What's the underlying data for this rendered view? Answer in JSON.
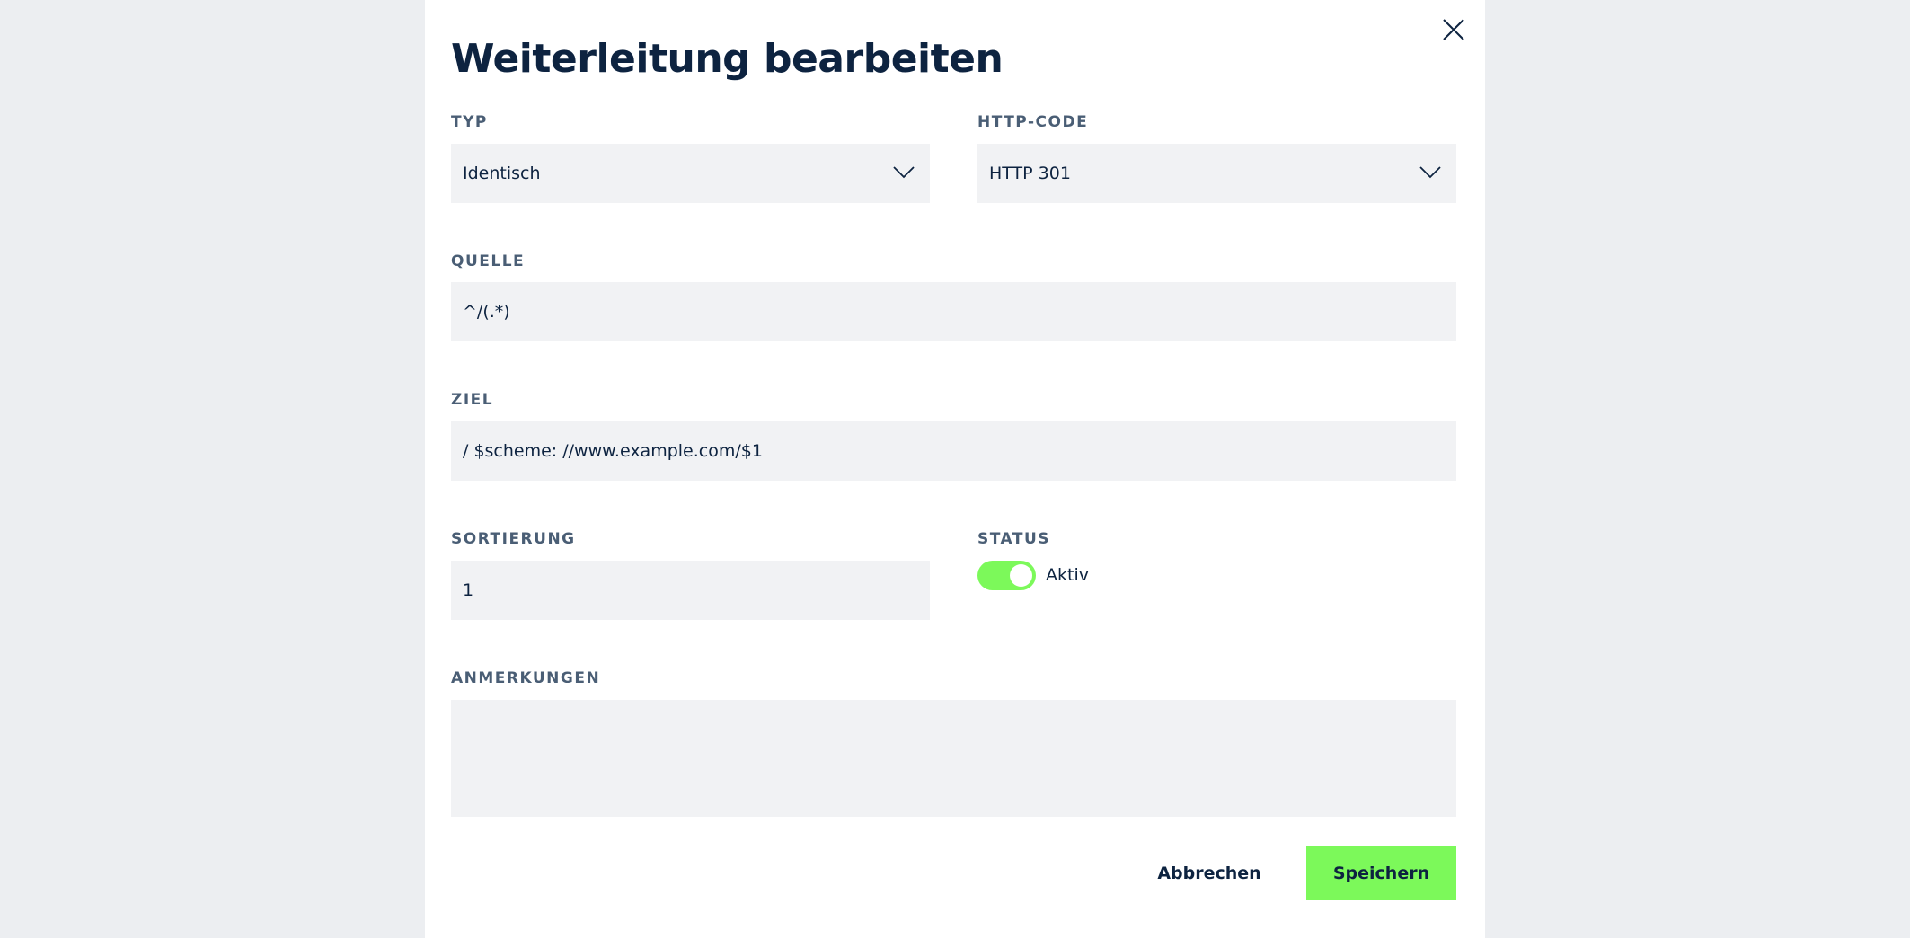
{
  "dialog": {
    "title": "Weiterleitung bearbeiten"
  },
  "fields": {
    "typ": {
      "label": "TYP",
      "value": "Identisch"
    },
    "http_code": {
      "label": "HTTP-CODE",
      "value": "HTTP 301"
    },
    "quelle": {
      "label": "QUELLE",
      "value": "^/(.*)"
    },
    "ziel": {
      "label": "ZIEL",
      "value": "/ $scheme: //www.example.com/$1"
    },
    "sortierung": {
      "label": "SORTIERUNG",
      "value": "1"
    },
    "status": {
      "label": "STATUS",
      "toggle_label": "Aktiv",
      "enabled": true
    },
    "anmerkungen": {
      "label": "ANMERKUNGEN",
      "value": ""
    }
  },
  "actions": {
    "cancel_label": "Abbrechen",
    "save_label": "Speichern"
  },
  "icons": {
    "close": "close-icon",
    "dropdown": "chevron-down-icon"
  },
  "colors": {
    "accent": "#7cf95a",
    "text": "#0d2340",
    "label": "#4a5e75",
    "field_bg": "#f1f2f4",
    "backdrop": "#eceef1"
  }
}
